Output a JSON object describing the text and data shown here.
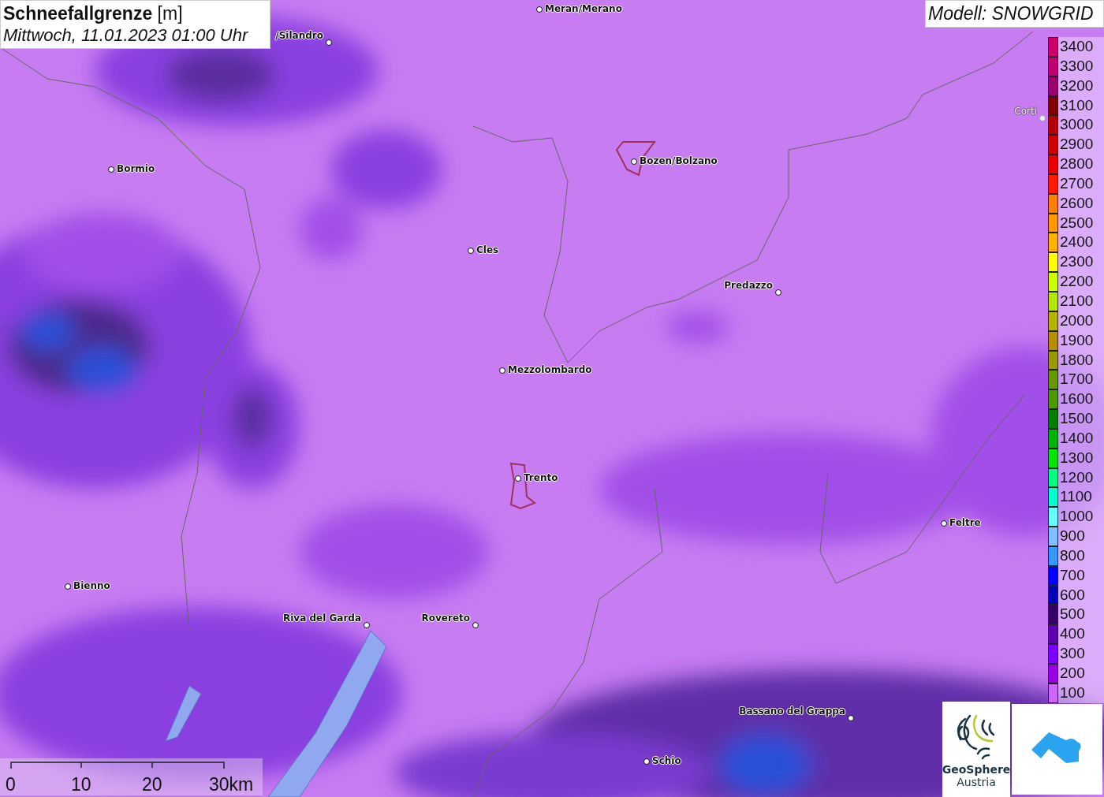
{
  "title": {
    "heading": "**Schneefallgrenze** [m]",
    "datetime": "Mittwoch, 11.01.2023 01:00 Uhr"
  },
  "model_label": "Modell: SNOWGRID",
  "cities": [
    {
      "name": "Meran/Merano",
      "faded": false
    },
    {
      "name": "/Silandro",
      "faded": false
    },
    {
      "name": "Bormio",
      "faded": false
    },
    {
      "name": "Bozen/Bolzano",
      "faded": false
    },
    {
      "name": "Cles",
      "faded": false
    },
    {
      "name": "Predazzo",
      "faded": false
    },
    {
      "name": "Mezzolombardo",
      "faded": false
    },
    {
      "name": "Trento",
      "faded": false
    },
    {
      "name": "Feltre",
      "faded": false
    },
    {
      "name": "Bienno",
      "faded": false
    },
    {
      "name": "Riva del Garda",
      "faded": false
    },
    {
      "name": "Rovereto",
      "faded": false
    },
    {
      "name": "Bassano del Grappa",
      "faded": false
    },
    {
      "name": "Schio",
      "faded": false
    },
    {
      "name": "Corti",
      "faded": true
    }
  ],
  "legend": [
    {
      "label": "3400",
      "color": "#cc0066"
    },
    {
      "label": "3300",
      "color": "#c0006e"
    },
    {
      "label": "3200",
      "color": "#99006e"
    },
    {
      "label": "3100",
      "color": "#800000"
    },
    {
      "label": "3000",
      "color": "#b30000"
    },
    {
      "label": "2900",
      "color": "#cc0000"
    },
    {
      "label": "2800",
      "color": "#e60000"
    },
    {
      "label": "2700",
      "color": "#ff1a00"
    },
    {
      "label": "2600",
      "color": "#ff8000"
    },
    {
      "label": "2500",
      "color": "#ff9900"
    },
    {
      "label": "2400",
      "color": "#ffb300"
    },
    {
      "label": "2300",
      "color": "#ffff00"
    },
    {
      "label": "2200",
      "color": "#ccff00"
    },
    {
      "label": "2100",
      "color": "#b3e600"
    },
    {
      "label": "2000",
      "color": "#b3b300"
    },
    {
      "label": "1900",
      "color": "#b38f00"
    },
    {
      "label": "1800",
      "color": "#999900"
    },
    {
      "label": "1700",
      "color": "#669900"
    },
    {
      "label": "1600",
      "color": "#4d9900"
    },
    {
      "label": "1500",
      "color": "#008000"
    },
    {
      "label": "1400",
      "color": "#00b300"
    },
    {
      "label": "1300",
      "color": "#00e600"
    },
    {
      "label": "1200",
      "color": "#00ff80"
    },
    {
      "label": "1100",
      "color": "#00ffcc"
    },
    {
      "label": "1000",
      "color": "#66ffff"
    },
    {
      "label": "900",
      "color": "#80c0ff"
    },
    {
      "label": "800",
      "color": "#3399ff"
    },
    {
      "label": "700",
      "color": "#0000ff"
    },
    {
      "label": "600",
      "color": "#0000b3"
    },
    {
      "label": "500",
      "color": "#330066"
    },
    {
      "label": "400",
      "color": "#5c00b3"
    },
    {
      "label": "300",
      "color": "#7a00ff"
    },
    {
      "label": "200",
      "color": "#9900e6"
    },
    {
      "label": "100",
      "color": "#cc66ff"
    }
  ],
  "scale_bar": {
    "ticks": [
      "0",
      "10",
      "20",
      "30km"
    ]
  },
  "logo": {
    "name": "GeoSphere",
    "country": "Austria"
  }
}
